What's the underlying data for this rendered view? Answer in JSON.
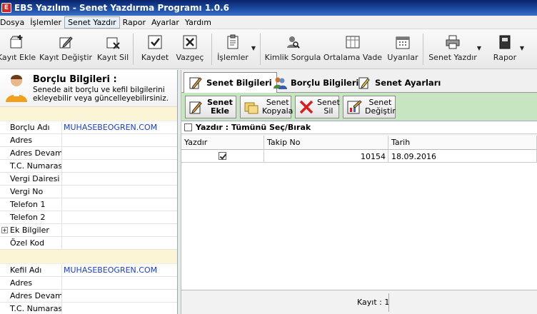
{
  "window": {
    "title": "EBS Yazılım - Senet Yazdırma Programı 1.0.6"
  },
  "menu": [
    "Dosya",
    "İşlemler",
    "Senet Yazdır",
    "Rapor",
    "Ayarlar",
    "Yardım"
  ],
  "menu_active_index": 2,
  "toolbar": {
    "kayit_ekle": "Kayıt Ekle",
    "kayit_degistir": "Kayıt Değiştir",
    "kayit_sil": "Kayıt Sil",
    "kaydet": "Kaydet",
    "vazgec": "Vazgeç",
    "islemler": "İşlemler",
    "kimlik_sorgula": "Kimlik Sorgula",
    "ortalama_vade": "Ortalama Vade",
    "uyarilar": "Uyarılar",
    "senet_yazdir": "Senet Yazdır",
    "rapor": "Rapor"
  },
  "left": {
    "title": "Borçlu Bilgileri :",
    "subtitle": "Senede ait borçlu ve kefil bilgilerini ekleyebilir veya güncelleyebilirsiniz.",
    "section1": "",
    "borclu_rows": [
      {
        "k": "Borçlu Adı",
        "v": "MUHASEBEOGREN.COM"
      },
      {
        "k": "Adres",
        "v": ""
      },
      {
        "k": "Adres Devamı",
        "v": ""
      },
      {
        "k": "T.C. Numarası",
        "v": ""
      },
      {
        "k": "Vergi Dairesi",
        "v": ""
      },
      {
        "k": "Vergi No",
        "v": ""
      },
      {
        "k": "Telefon 1",
        "v": ""
      },
      {
        "k": "Telefon 2",
        "v": ""
      },
      {
        "k": "Ek Bilgiler",
        "v": ""
      },
      {
        "k": "Özel Kod",
        "v": ""
      }
    ],
    "section2": "",
    "kefil_rows": [
      {
        "k": "Kefil Adı",
        "v": "MUHASEBEOGREN.COM"
      },
      {
        "k": "Adres",
        "v": ""
      },
      {
        "k": "Adres Devamı",
        "v": ""
      },
      {
        "k": "T.C. Numarası",
        "v": ""
      }
    ]
  },
  "tabs": [
    "Senet Bilgileri",
    "Borçlu Bilgileri",
    "Senet Ayarları"
  ],
  "actions": {
    "ekle": [
      "Senet",
      "Ekle"
    ],
    "kopyala": [
      "Senet",
      "Kopyala"
    ],
    "sil": [
      "Senet",
      "Sil"
    ],
    "degistir": [
      "Senet",
      "Değiştir"
    ]
  },
  "select_all": "Yazdır : Tümünü Seç/Bırak",
  "grid": {
    "headers": [
      "Yazdır",
      "Takip No",
      "Tarih"
    ],
    "rows": [
      {
        "yazdir": true,
        "takip_no": "10154",
        "tarih": "18.09.2016"
      }
    ]
  },
  "footer": {
    "kayit": "Kayıt : 1"
  },
  "colors": {
    "title_bar": "#1e4fa6",
    "action_bar": "#c6e5c0",
    "link_text": "#1a3fd0",
    "section_bg": "#fbf5d5"
  }
}
